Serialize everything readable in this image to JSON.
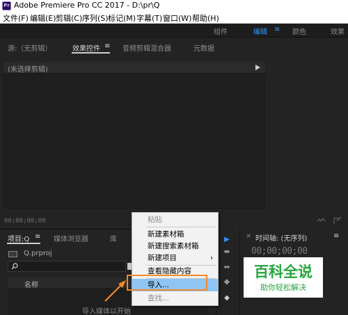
{
  "window": {
    "app_icon": "Pr",
    "title": "Adobe Premiere Pro CC 2017 - D:\\pr\\Q"
  },
  "menu": [
    "文件(F)",
    "编辑(E)",
    "剪辑(C)",
    "序列(S)",
    "标记(M)",
    "字幕(T)",
    "窗口(W)",
    "帮助(H)"
  ],
  "workspaces": {
    "items": [
      "组件",
      "编辑",
      "颜色",
      "效果"
    ],
    "active": "编辑",
    "menu_glyph": "≡"
  },
  "source_panel": {
    "tabs": [
      "源:（无剪辑）",
      "效果控件",
      "音频剪辑混合器",
      "元数据"
    ],
    "active_tab": "效果控件",
    "tab_menu_glyph": "≡",
    "clip_header": "(未选择剪辑)",
    "timecode": "00;00;00;00"
  },
  "project_panel": {
    "tabs": [
      "项目:Q",
      "媒体浏览器",
      "库"
    ],
    "tab_menu_glyph": "≡",
    "file_name": "Q.prproj",
    "column_name": "名称",
    "empty_hint": "导入媒体以开始"
  },
  "tools": [
    "▶",
    "⇹",
    "⇔",
    "✥",
    "◆"
  ],
  "timeline_panel": {
    "title": "时间轴: (无序列)",
    "menu_glyph": "≡",
    "timecode": "00;00;00;00"
  },
  "context_menu": {
    "items": [
      {
        "label": "粘贴",
        "enabled": false
      },
      {
        "label": "新建素材箱",
        "enabled": true
      },
      {
        "label": "新建搜索素材箱",
        "enabled": true
      },
      {
        "label": "新建项目",
        "enabled": true,
        "submenu": true
      },
      {
        "label": "查看隐藏内容",
        "enabled": true
      },
      {
        "label": "导入...",
        "enabled": true,
        "highlighted": true
      },
      {
        "label": "查找...",
        "enabled": false
      }
    ],
    "highlight_color": "#8ec5f2",
    "callout_color": "#f28a2a"
  },
  "watermark": {
    "main": "百科全说",
    "sub": "助你轻松解决",
    "color": "#27a53f"
  }
}
